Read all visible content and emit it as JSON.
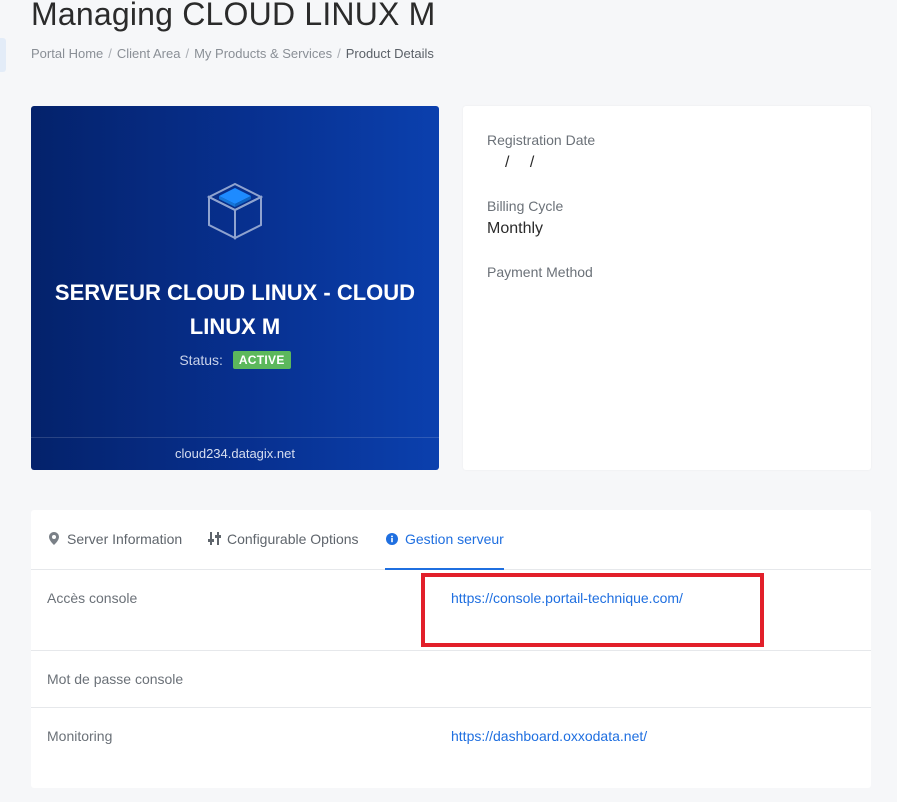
{
  "page": {
    "title": "Managing CLOUD LINUX M"
  },
  "breadcrumb": {
    "items": [
      "Portal Home",
      "Client Area",
      "My Products & Services"
    ],
    "current": "Product Details",
    "separator": "/"
  },
  "product": {
    "name": "SERVEUR CLOUD LINUX - CLOUD LINUX M",
    "status_label": "Status:",
    "status": "ACTIVE",
    "domain": "cloud234.datagix.net",
    "icon": "cube-icon"
  },
  "info": {
    "registration_date_label": "Registration Date",
    "registration_date_value": "/ /",
    "billing_cycle_label": "Billing Cycle",
    "billing_cycle_value": "Monthly",
    "payment_method_label": "Payment Method"
  },
  "tabs": [
    {
      "label": "Server Information",
      "icon": "map-marker-icon",
      "active": false
    },
    {
      "label": "Configurable Options",
      "icon": "sliders-icon",
      "active": false
    },
    {
      "label": "Gestion serveur",
      "icon": "info-circle-icon",
      "active": true
    }
  ],
  "rows": [
    {
      "label": "Accès console",
      "value": "https://console.portail-technique.com/"
    },
    {
      "label": "Mot de passe console",
      "value": ""
    },
    {
      "label": "Monitoring",
      "value": "https://dashboard.oxxodata.net/"
    }
  ],
  "colors": {
    "accent": "#1f6fe0",
    "active_badge": "#5cb85c",
    "highlight": "#e21f2a",
    "card_gradient_start": "#04226b",
    "card_gradient_end": "#0b40ae"
  }
}
